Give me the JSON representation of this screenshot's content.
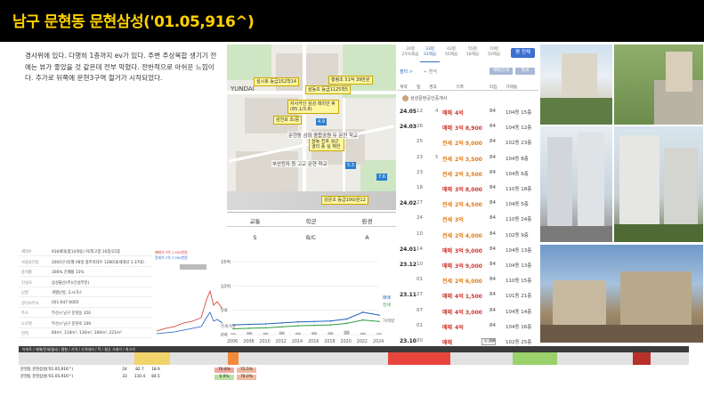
{
  "banner": {
    "title": "남구 문현동 문현삼성('01.05,916^)"
  },
  "description": {
    "text": "경사위에 있다. 다행히 1층까지 ev가 있다. 주변 주상복합 생기기 전에는 뷰가 좋았을 것 같은데 전부 막혔다. 전반적으로 아쉬운 느낌이다. 추가로 뒤쪽에 문현3구역 철거가 시작되었다."
  },
  "map": {
    "area_label": "YUNDAI",
    "pins": [
      {
        "text": "설시호 등급152학14",
        "type": "yellow"
      },
      {
        "text": "삼동초 등급1125학5",
        "type": "yellow"
      },
      {
        "text": "황령초 51억 39만원",
        "type": "yellow"
      },
      {
        "text": "자사카인 삼성 래미안 휴 (85.1/3.8)",
        "type": "yellow"
      },
      {
        "text": "삼천포 초/중",
        "type": "yellow"
      },
      {
        "text": "삼동 전포 실근 결리 풍 실 제한",
        "type": "yellow"
      },
      {
        "text": "강문초 등급100/원12",
        "type": "yellow"
      },
      {
        "text": "4.9",
        "type": "blue"
      },
      {
        "text": "5.3",
        "type": "blue"
      },
      {
        "text": "7.6",
        "type": "blue"
      }
    ],
    "school_label": "부산전자 등 고교 문현 학교",
    "park_label": "문현동 삼화 종합공원 두 문현 학교"
  },
  "grades": {
    "headers": [
      "교통",
      "학군",
      "환경"
    ],
    "values": [
      "S",
      "B/C",
      "A"
    ]
  },
  "transactions": {
    "tabs": [
      {
        "size": "24평",
        "area": "25%제곱"
      },
      {
        "size": "33평",
        "area": "33제곱"
      },
      {
        "size": "42평",
        "area": "50제곱"
      },
      {
        "size": "55평",
        "area": "18제곱"
      },
      {
        "size": "70평",
        "area": "50제곱"
      }
    ],
    "more_button": "평 전체",
    "filter_label": "필터 >",
    "filter_sub": "← 면적",
    "chips": [
      "매매/전세",
      "월세"
    ],
    "headers": [
      "계약",
      "일",
      "경과",
      "가격",
      "타입",
      "거래동"
    ],
    "agent": "삼성문현공인중개사",
    "rows": [
      {
        "date": "24.05",
        "day": "12",
        "kind": "4",
        "type": "매매",
        "price": "4억",
        "area": "84",
        "floor": "104동 15층"
      },
      {
        "date": "24.03",
        "day": "26",
        "kind": "",
        "type": "매매",
        "price": "3억 8,900",
        "area": "84",
        "floor": "104동 12층"
      },
      {
        "date": "",
        "day": "25",
        "kind": "",
        "type": "전세",
        "price": "2억 9,000",
        "area": "84",
        "floor": "102동 23층"
      },
      {
        "date": "",
        "day": "23",
        "kind": "5",
        "type": "전세",
        "price": "2억 3,500",
        "area": "84",
        "floor": "104동 8층"
      },
      {
        "date": "",
        "day": "23",
        "kind": "",
        "type": "전세",
        "price": "2억 3,500",
        "area": "84",
        "floor": "104동 6층"
      },
      {
        "date": "",
        "day": "18",
        "kind": "",
        "type": "매매",
        "price": "3억 8,000",
        "area": "84",
        "floor": "110동 18층"
      },
      {
        "date": "24.02",
        "day": "27",
        "kind": "",
        "type": "전세",
        "price": "2억 4,500",
        "area": "84",
        "floor": "104동 5층"
      },
      {
        "date": "",
        "day": "24",
        "kind": "",
        "type": "전세",
        "price": "3억",
        "area": "84",
        "floor": "110동 24층"
      },
      {
        "date": "",
        "day": "10",
        "kind": "",
        "type": "전세",
        "price": "2억 4,000",
        "area": "84",
        "floor": "102동 9층"
      },
      {
        "date": "24.01",
        "day": "14",
        "kind": "",
        "type": "매매",
        "price": "3억 9,000",
        "area": "84",
        "floor": "104동 13층"
      },
      {
        "date": "23.12",
        "day": "10",
        "kind": "",
        "type": "매매",
        "price": "3억 9,000",
        "area": "84",
        "floor": "104동 13층"
      },
      {
        "date": "",
        "day": "01",
        "kind": "",
        "type": "전세",
        "price": "2억 6,000",
        "area": "84",
        "floor": "110동 15층"
      },
      {
        "date": "23.11",
        "day": "27",
        "kind": "",
        "type": "매매",
        "price": "4억 1,500",
        "area": "84",
        "floor": "101동 21층"
      },
      {
        "date": "",
        "day": "07",
        "kind": "",
        "type": "매매",
        "price": "4억 3,000",
        "area": "84",
        "floor": "104동 14층"
      },
      {
        "date": "",
        "day": "01",
        "kind": "",
        "type": "매매",
        "price": "4억",
        "area": "84",
        "floor": "104동 16층"
      },
      {
        "date": "23.10",
        "day": "30",
        "kind": "",
        "type": "매매",
        "price": "",
        "area": "84",
        "floor": "102동 25층"
      }
    ],
    "cancel_tag": "계약해"
  },
  "info_card": {
    "rows": [
      {
        "k": "세대수",
        "v": "916세대(총14개동)    저/최고층    16층/25층"
      },
      {
        "k": "사용승인일",
        "v": "2001년 05월 08일    총주차대수    1280대(세대당 1.37대)"
      },
      {
        "k": "용적률",
        "v": "306%    건폐율    15%"
      },
      {
        "k": "건설사",
        "v": "삼성물산(주)(건설부문)"
      },
      {
        "k": "난방",
        "v": "개별난방, 도시가스"
      },
      {
        "k": "관리사무소",
        "v": "051-647-0005"
      },
      {
        "k": "주소",
        "v": "부산시 남구 문현동 350"
      },
      {
        "k": "도로명",
        "v": "부산시 남구 문현로 109"
      },
      {
        "k": "면적",
        "v": "84m², 110m², 136m², 166m², 221m²"
      }
    ]
  },
  "trend": {
    "legend": [
      "매매가 3억 1,930만원",
      "전세가 1억 7,050만원"
    ]
  },
  "chart_data": {
    "type": "line",
    "title": "",
    "ylabel": "",
    "y_ticks": [
      "15억",
      "10억",
      "5억",
      "0억"
    ],
    "ylim": [
      0,
      15
    ],
    "x": [
      2006,
      2008,
      2010,
      2012,
      2014,
      2016,
      2018,
      2020,
      2022,
      2024
    ],
    "series": [
      {
        "name": "매매",
        "values": [
          2.0,
          2.1,
          2.2,
          2.4,
          2.6,
          2.7,
          2.8,
          3.2,
          4.6,
          4.0
        ],
        "color": "#1f5fbf"
      },
      {
        "name": "전세",
        "values": [
          1.2,
          1.3,
          1.4,
          1.6,
          1.8,
          1.9,
          2.0,
          2.3,
          3.0,
          2.7
        ],
        "color": "#2f9a43"
      },
      {
        "name": "거래량",
        "values": [
          0.3,
          0.5,
          0.4,
          0.6,
          0.4,
          0.5,
          0.5,
          0.8,
          0.4,
          0.3
        ],
        "color": "#777777"
      }
    ],
    "grid": true,
    "side_labels": [
      "매매",
      "전세",
      "거래량"
    ],
    "volume_label": "전세거래"
  },
  "bottom_table": {
    "title_row": "아파트 / 매매/전세/월세 / 평형 / 가격 / 가격대비 / 학 / 평균 거래가 / 최고가",
    "rows": [
      {
        "name": "문현동 문현삼성('01.05,916^)",
        "sz": "24",
        "v1": "82.7",
        "v2": "18.9",
        "pct1": "76.8%",
        "pct2": "72.5%"
      },
      {
        "name": "문현동 문현삼성('01.05,916^)",
        "sz": "33",
        "v1": "110.4",
        "v2": "84.5",
        "pct1": "0.0%",
        "pct2": "78.0%"
      }
    ]
  },
  "colors": {
    "banner_bg": "#000000",
    "banner_text": "#ffd200",
    "sale": "#d0342c",
    "jeonse": "#e07a16",
    "accent": "#3b6fd0"
  }
}
